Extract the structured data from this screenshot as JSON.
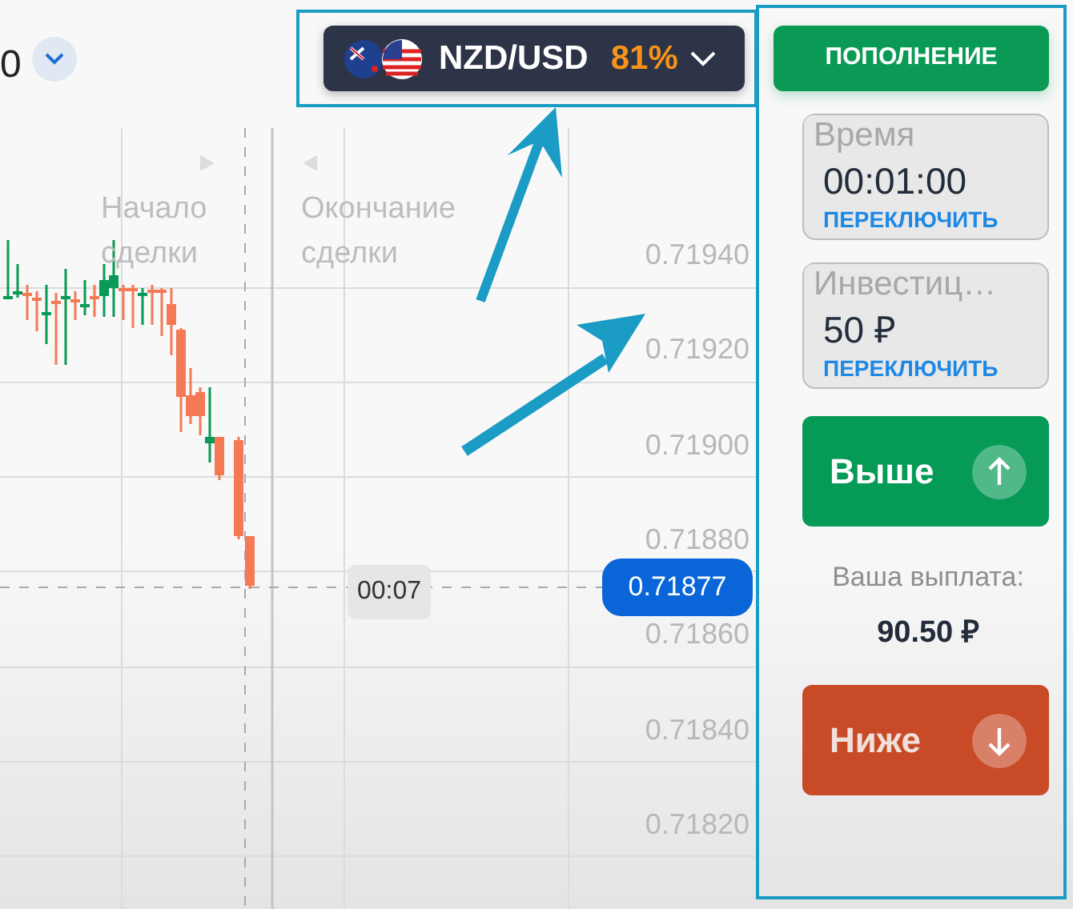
{
  "header": {
    "cut_value": "0",
    "pair": {
      "name": "NZD/USD",
      "payout_percent": "81%"
    }
  },
  "chart": {
    "start_label": "Начало сделки",
    "end_label": "Окончание сделки",
    "price_labels": [
      "0.71940",
      "0.71920",
      "0.71900",
      "0.71880",
      "0.71860",
      "0.71840",
      "0.71820"
    ],
    "timer": "00:07",
    "current_price": "0.71877"
  },
  "panel": {
    "deposit_button": "ПОПОЛНЕНИЕ",
    "fields": [
      {
        "label": "Время",
        "value": "00:01:00",
        "switch_link": "ПЕРЕКЛЮЧИТЬ"
      },
      {
        "label": "Инвестиц…",
        "value": "50 ₽",
        "switch_link": "ПЕРЕКЛЮЧИТЬ"
      }
    ],
    "buttons": [
      {
        "kind": "up",
        "label": "Выше"
      },
      {
        "kind": "payout",
        "label": "Ваша выплата:",
        "value": "90.50 ₽"
      },
      {
        "kind": "down",
        "label": "Ниже"
      }
    ]
  }
}
